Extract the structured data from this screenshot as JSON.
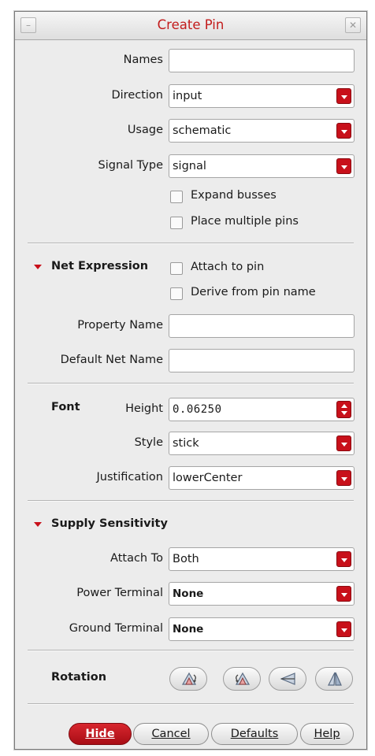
{
  "window": {
    "title": "Create Pin",
    "minimize_glyph": "–",
    "close_glyph": "✕"
  },
  "pin": {
    "names_label": "Names",
    "names_value": "",
    "direction_label": "Direction",
    "direction_value": "input",
    "usage_label": "Usage",
    "usage_value": "schematic",
    "signal_type_label": "Signal Type",
    "signal_type_value": "signal",
    "expand_busses_label": "Expand busses",
    "place_multiple_label": "Place multiple pins"
  },
  "net_expression": {
    "section_label": "Net Expression",
    "attach_to_pin_label": "Attach to pin",
    "derive_label": "Derive from pin name",
    "property_name_label": "Property Name",
    "property_name_value": "",
    "default_net_label": "Default Net Name",
    "default_net_value": ""
  },
  "font": {
    "section_label": "Font",
    "height_label": "Height",
    "height_value": "0.06250",
    "style_label": "Style",
    "style_value": "stick",
    "justification_label": "Justification",
    "justification_value": "lowerCenter"
  },
  "supply": {
    "section_label": "Supply Sensitivity",
    "attach_to_label": "Attach To",
    "attach_to_value": "Both",
    "power_label": "Power Terminal",
    "power_value": "None",
    "ground_label": "Ground Terminal",
    "ground_value": "None"
  },
  "rotation": {
    "label": "Rotation",
    "buttons": [
      "rotate-icon",
      "rotate-reverse-icon",
      "flip-horizontal-icon",
      "flip-vertical-icon"
    ]
  },
  "buttons": {
    "hide": "Hide",
    "cancel": "Cancel",
    "defaults": "Defaults",
    "help": "Help"
  },
  "colors": {
    "accent": "#c8101a",
    "title": "#c21b1b"
  }
}
